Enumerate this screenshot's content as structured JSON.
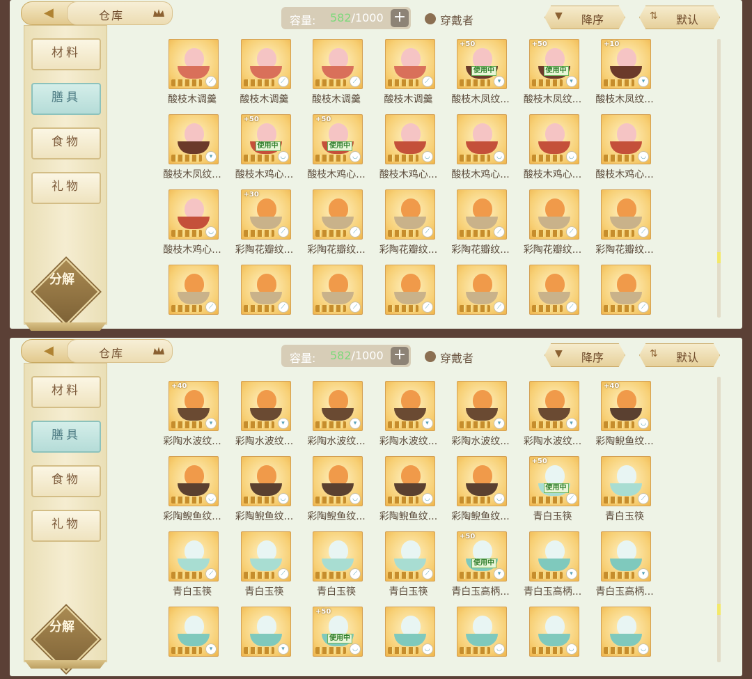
{
  "screens": [
    {
      "title": "仓库",
      "capacity_label": "容量:",
      "capacity_current": "582",
      "capacity_total": "/1000",
      "wearer_label": "穿戴者",
      "sort_label": "降序",
      "default_label": "默认",
      "categories": [
        "材料",
        "膳具",
        "食物",
        "礼物"
      ],
      "active_category": "膳具",
      "split_label": "分解",
      "items": [
        {
          "name": "酸枝木调羹",
          "bonus": "",
          "in_use": false,
          "type": "spoon",
          "color": "#d9705a"
        },
        {
          "name": "酸枝木调羹",
          "bonus": "",
          "in_use": false,
          "type": "spoon",
          "color": "#d9705a"
        },
        {
          "name": "酸枝木调羹",
          "bonus": "",
          "in_use": false,
          "type": "spoon",
          "color": "#d9705a"
        },
        {
          "name": "酸枝木调羹",
          "bonus": "",
          "in_use": false,
          "type": "spoon",
          "color": "#d9705a"
        },
        {
          "name": "酸枝木凤纹...",
          "bonus": "+50",
          "in_use": true,
          "type": "cup",
          "color": "#6b3a2a"
        },
        {
          "name": "酸枝木凤纹...",
          "bonus": "+50",
          "in_use": true,
          "type": "cup",
          "color": "#6b3a2a"
        },
        {
          "name": "酸枝木凤纹...",
          "bonus": "+10",
          "in_use": false,
          "type": "cup",
          "color": "#6b3a2a"
        },
        {
          "name": "酸枝木凤纹...",
          "bonus": "",
          "in_use": false,
          "type": "cup",
          "color": "#6b3a2a"
        },
        {
          "name": "酸枝木鸡心...",
          "bonus": "+50",
          "in_use": true,
          "type": "bowl",
          "color": "#c4503a"
        },
        {
          "name": "酸枝木鸡心...",
          "bonus": "+50",
          "in_use": true,
          "type": "bowl",
          "color": "#c4503a"
        },
        {
          "name": "酸枝木鸡心...",
          "bonus": "",
          "in_use": false,
          "type": "bowl",
          "color": "#c4503a"
        },
        {
          "name": "酸枝木鸡心...",
          "bonus": "",
          "in_use": false,
          "type": "bowl",
          "color": "#c4503a"
        },
        {
          "name": "酸枝木鸡心...",
          "bonus": "",
          "in_use": false,
          "type": "bowl",
          "color": "#c4503a"
        },
        {
          "name": "酸枝木鸡心...",
          "bonus": "",
          "in_use": false,
          "type": "bowl",
          "color": "#c4503a"
        },
        {
          "name": "酸枝木鸡心...",
          "bonus": "",
          "in_use": false,
          "type": "bowl",
          "color": "#c4503a"
        },
        {
          "name": "彩陶花瓣纹...",
          "bonus": "+30",
          "in_use": false,
          "type": "spoon",
          "color": "#c9b28a"
        },
        {
          "name": "彩陶花瓣纹...",
          "bonus": "",
          "in_use": false,
          "type": "spoon",
          "color": "#c9b28a"
        },
        {
          "name": "彩陶花瓣纹...",
          "bonus": "",
          "in_use": false,
          "type": "spoon",
          "color": "#c9b28a"
        },
        {
          "name": "彩陶花瓣纹...",
          "bonus": "",
          "in_use": false,
          "type": "spoon",
          "color": "#c9b28a"
        },
        {
          "name": "彩陶花瓣纹...",
          "bonus": "",
          "in_use": false,
          "type": "spoon",
          "color": "#c9b28a"
        },
        {
          "name": "彩陶花瓣纹...",
          "bonus": "",
          "in_use": false,
          "type": "spoon",
          "color": "#c9b28a"
        },
        {
          "name": "",
          "bonus": "",
          "in_use": false,
          "type": "spoon",
          "color": "#c9b28a"
        },
        {
          "name": "",
          "bonus": "",
          "in_use": false,
          "type": "spoon",
          "color": "#c9b28a"
        },
        {
          "name": "",
          "bonus": "",
          "in_use": false,
          "type": "spoon",
          "color": "#c9b28a"
        },
        {
          "name": "",
          "bonus": "",
          "in_use": false,
          "type": "spoon",
          "color": "#c9b28a"
        },
        {
          "name": "",
          "bonus": "",
          "in_use": false,
          "type": "spoon",
          "color": "#c9b28a"
        },
        {
          "name": "",
          "bonus": "",
          "in_use": false,
          "type": "spoon",
          "color": "#c9b28a"
        },
        {
          "name": "",
          "bonus": "",
          "in_use": false,
          "type": "spoon",
          "color": "#c9b28a"
        }
      ]
    },
    {
      "title": "仓库",
      "capacity_label": "容量:",
      "capacity_current": "582",
      "capacity_total": "/1000",
      "wearer_label": "穿戴者",
      "sort_label": "降序",
      "default_label": "默认",
      "categories": [
        "材料",
        "膳具",
        "食物",
        "礼物"
      ],
      "active_category": "膳具",
      "split_label": "分解",
      "items": [
        {
          "name": "彩陶水波纹...",
          "bonus": "+40",
          "in_use": false,
          "type": "cup",
          "color": "#6a4a32"
        },
        {
          "name": "彩陶水波纹...",
          "bonus": "",
          "in_use": false,
          "type": "cup",
          "color": "#6a4a32"
        },
        {
          "name": "彩陶水波纹...",
          "bonus": "",
          "in_use": false,
          "type": "cup",
          "color": "#6a4a32"
        },
        {
          "name": "彩陶水波纹...",
          "bonus": "",
          "in_use": false,
          "type": "cup",
          "color": "#6a4a32"
        },
        {
          "name": "彩陶水波纹...",
          "bonus": "",
          "in_use": false,
          "type": "cup",
          "color": "#6a4a32"
        },
        {
          "name": "彩陶水波纹...",
          "bonus": "",
          "in_use": false,
          "type": "cup",
          "color": "#6a4a32"
        },
        {
          "name": "彩陶鲵鱼纹...",
          "bonus": "+40",
          "in_use": false,
          "type": "bowl",
          "color": "#5a4030"
        },
        {
          "name": "彩陶鲵鱼纹...",
          "bonus": "",
          "in_use": false,
          "type": "bowl",
          "color": "#5a4030"
        },
        {
          "name": "彩陶鲵鱼纹...",
          "bonus": "",
          "in_use": false,
          "type": "bowl",
          "color": "#5a4030"
        },
        {
          "name": "彩陶鲵鱼纹...",
          "bonus": "",
          "in_use": false,
          "type": "bowl",
          "color": "#5a4030"
        },
        {
          "name": "彩陶鲵鱼纹...",
          "bonus": "",
          "in_use": false,
          "type": "bowl",
          "color": "#5a4030"
        },
        {
          "name": "彩陶鲵鱼纹...",
          "bonus": "",
          "in_use": false,
          "type": "bowl",
          "color": "#5a4030"
        },
        {
          "name": "青白玉筷",
          "bonus": "+50",
          "in_use": true,
          "type": "spoon",
          "color": "#a8ddd2"
        },
        {
          "name": "青白玉筷",
          "bonus": "",
          "in_use": false,
          "type": "spoon",
          "color": "#a8ddd2"
        },
        {
          "name": "青白玉筷",
          "bonus": "",
          "in_use": false,
          "type": "spoon",
          "color": "#a8ddd2"
        },
        {
          "name": "青白玉筷",
          "bonus": "",
          "in_use": false,
          "type": "spoon",
          "color": "#a8ddd2"
        },
        {
          "name": "青白玉筷",
          "bonus": "",
          "in_use": false,
          "type": "spoon",
          "color": "#a8ddd2"
        },
        {
          "name": "青白玉筷",
          "bonus": "",
          "in_use": false,
          "type": "spoon",
          "color": "#a8ddd2"
        },
        {
          "name": "青白玉高柄...",
          "bonus": "+50",
          "in_use": true,
          "type": "cup",
          "color": "#7fc9bd"
        },
        {
          "name": "青白玉高柄...",
          "bonus": "",
          "in_use": false,
          "type": "cup",
          "color": "#7fc9bd"
        },
        {
          "name": "青白玉高柄...",
          "bonus": "",
          "in_use": false,
          "type": "cup",
          "color": "#7fc9bd"
        },
        {
          "name": "",
          "bonus": "",
          "in_use": false,
          "type": "cup",
          "color": "#7fc9bd"
        },
        {
          "name": "",
          "bonus": "",
          "in_use": false,
          "type": "cup",
          "color": "#7fc9bd"
        },
        {
          "name": "",
          "bonus": "+50",
          "in_use": true,
          "type": "bowl",
          "color": "#7fc9bd"
        },
        {
          "name": "",
          "bonus": "",
          "in_use": false,
          "type": "bowl",
          "color": "#7fc9bd"
        },
        {
          "name": "",
          "bonus": "",
          "in_use": false,
          "type": "bowl",
          "color": "#7fc9bd"
        },
        {
          "name": "",
          "bonus": "",
          "in_use": false,
          "type": "bowl",
          "color": "#7fc9bd"
        },
        {
          "name": "",
          "bonus": "",
          "in_use": false,
          "type": "bowl",
          "color": "#7fc9bd"
        }
      ]
    }
  ],
  "in_use_label": "使用中",
  "type_icons": {
    "spoon": "spoon-icon",
    "cup": "cup-icon",
    "bowl": "bowl-icon"
  }
}
